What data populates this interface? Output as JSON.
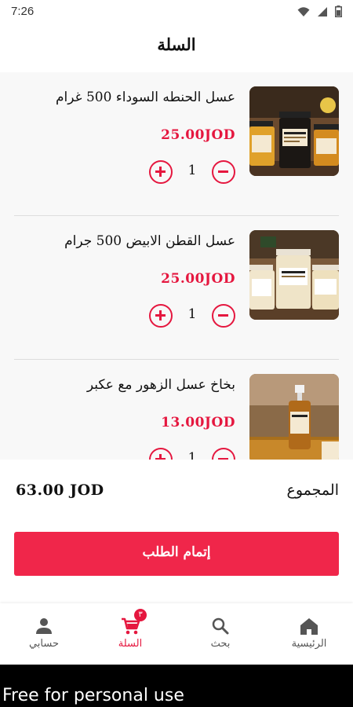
{
  "status_bar": {
    "time": "7:26",
    "icons": [
      "wifi-icon",
      "signal-icon",
      "battery-icon"
    ]
  },
  "header": {
    "title": "السلة"
  },
  "cart": {
    "items": [
      {
        "name": "عسل الحنطه السوداء 500 غرام",
        "price": "25.00JOD",
        "quantity": "1",
        "image": "honey-jars-photo"
      },
      {
        "name": "عسل القطن الابيض 500 جرام",
        "price": "25.00JOD",
        "quantity": "1",
        "image": "white-honey-jars-photo"
      },
      {
        "name": "بخاخ عسل الزهور مع عكبر",
        "price": "13.00JOD",
        "quantity": "1",
        "image": "honey-spray-bottle-photo"
      }
    ]
  },
  "total": {
    "label": "المجموع",
    "value": "63.00 JOD"
  },
  "checkout": {
    "label": "إتمام الطلب"
  },
  "bottom_nav": {
    "items": [
      {
        "label": "حسابي",
        "icon": "person-icon"
      },
      {
        "label": "السلة",
        "icon": "cart-icon",
        "badge": "٣",
        "active": true
      },
      {
        "label": "بحث",
        "icon": "search-icon"
      },
      {
        "label": "الرئيسية",
        "icon": "home-icon"
      }
    ]
  },
  "footer": {
    "text": "Free for personal use"
  },
  "colors": {
    "accent": "#e5173f",
    "button": "#f0264a",
    "list_background": "#f8f8f8",
    "footer_background": "#000000"
  }
}
